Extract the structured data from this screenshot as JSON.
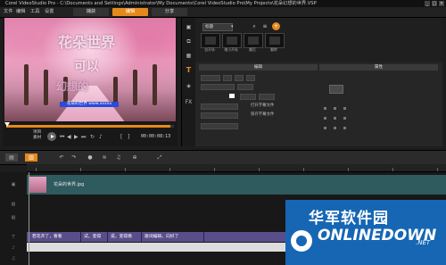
{
  "window": {
    "title": "Corel VideoStudio Pro - C:\\Documents and Settings\\Administrator\\My Documents\\Corel VideoStudio Pro\\My Projects\\花朵幻想的世界.VSP",
    "controls": [
      "_",
      "□",
      "×"
    ]
  },
  "menu": {
    "items": [
      "文件",
      "编辑",
      "工具",
      "设置"
    ],
    "steps": [
      "捕获",
      "编辑",
      "分享"
    ],
    "active_step": "编辑"
  },
  "preview": {
    "title_lines": [
      "花朵世界",
      "可以",
      "幻想的"
    ],
    "caption": "花朵的世界 www.xxxxx",
    "project_label": "项目",
    "clip_label": "素材",
    "timecode": "00:00:08:13",
    "progress": 0.98
  },
  "library": {
    "category": "标题",
    "thumb_labels": [
      "自开场",
      "缩小开场",
      "翻页",
      "翻转"
    ],
    "options_tabs": [
      "编辑",
      "属性"
    ],
    "open_subtitle": "打开字幕文件",
    "save_subtitle": "保存字幕文件"
  },
  "timeline": {
    "video_clip_label": "花朵的世界.jpg",
    "title_segments": [
      "若花开了，看看",
      "试，变得",
      "说，变得看",
      "歌词编辑，向好了"
    ]
  },
  "watermark": {
    "cn": "华军软件园",
    "en": "ONLINEDOWN",
    "suffix": ".NET"
  },
  "colors": {
    "accent": "#e48a1c",
    "video_track": "#2f5a5e",
    "title_track": "#5a4e8a",
    "watermark_bg": "#1666b4"
  },
  "icons": [
    "minimize-icon",
    "maximize-icon",
    "close-icon",
    "play-icon",
    "home-icon",
    "rewind-icon",
    "fast-forward-icon",
    "end-icon",
    "loop-icon",
    "volume-icon",
    "text-tool-icon",
    "fx-icon",
    "media-icon",
    "transition-icon",
    "graphic-icon",
    "filter-icon",
    "undo-icon",
    "redo-icon",
    "record-icon",
    "mix-icon",
    "zoom-icon",
    "lock-icon",
    "video-track-icon",
    "overlay-track-icon",
    "title-track-icon",
    "voice-track-icon",
    "music-track-icon"
  ]
}
